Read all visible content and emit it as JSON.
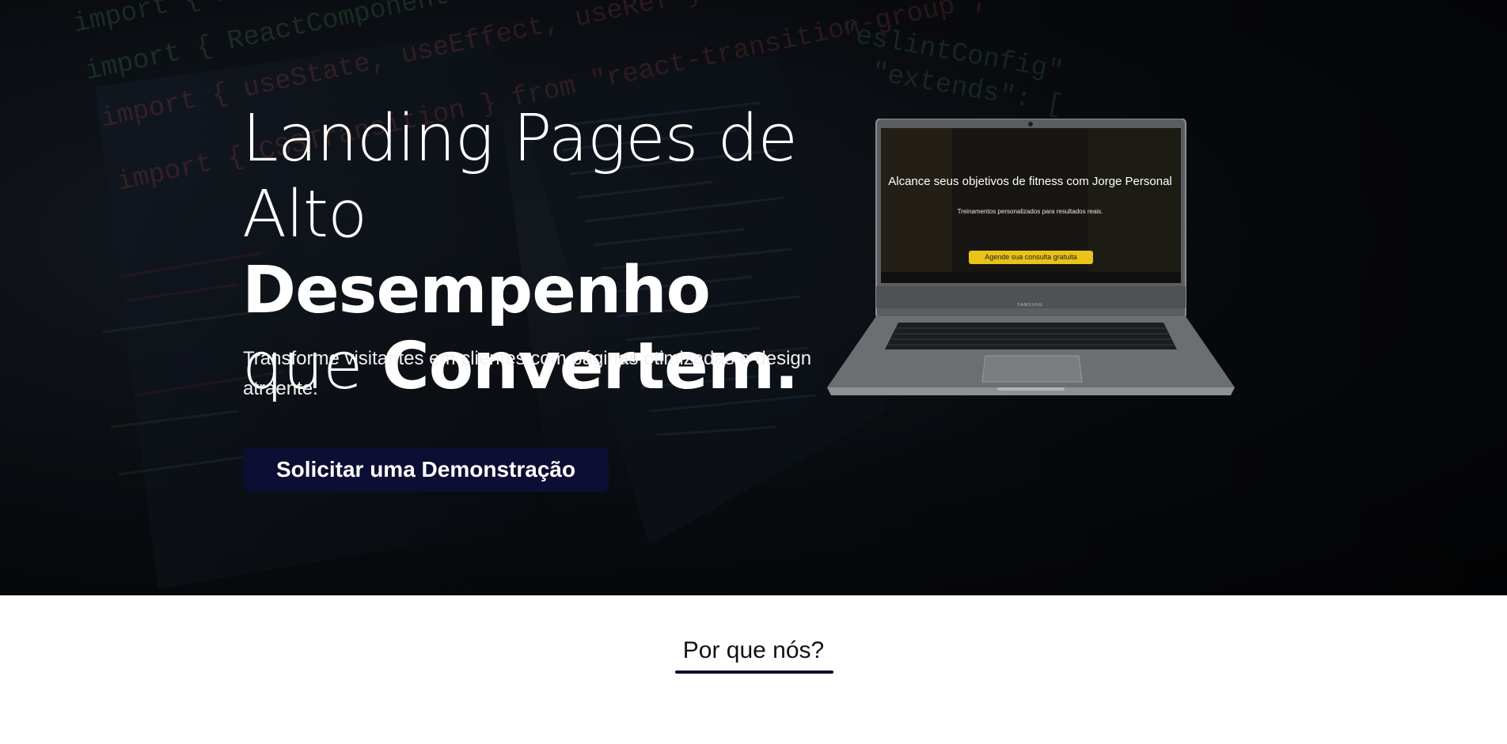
{
  "hero": {
    "headline": {
      "line1": "Landing Pages de",
      "line2_light": "Alto ",
      "line2_bold": "Desempenho",
      "line3_light": "que ",
      "line3_bold": "Convertem."
    },
    "subtitle": "Transforme visitantes em clientes com páginas otimizadas e design atraente.",
    "cta_label": "Solicitar uma Demonstração",
    "laptop": {
      "screen_title": "Alcance seus objetivos de fitness com Jorge Personal",
      "screen_subtitle": "Treinamentos personalizados para resultados reais.",
      "screen_button": "Agende sua consulta gratuita",
      "brand": "SAMSUNG"
    },
    "background_code": [
      "import { ReactComponent as BoltIcon } from",
      "import { ReactComponent as RightArrowIcon } from",
      "import { useState, useEffect, useRef } from \"react\";",
      "import { CSSTransition } from \"react-transition-group\";",
      "\"eslintConfig\"",
      "\"extends\": ["
    ]
  },
  "why_us": {
    "title": "Por que nós?"
  },
  "colors": {
    "cta_bg": "#0d0e33",
    "underline": "#0d0e33",
    "screen_button": "#e9c31a"
  }
}
